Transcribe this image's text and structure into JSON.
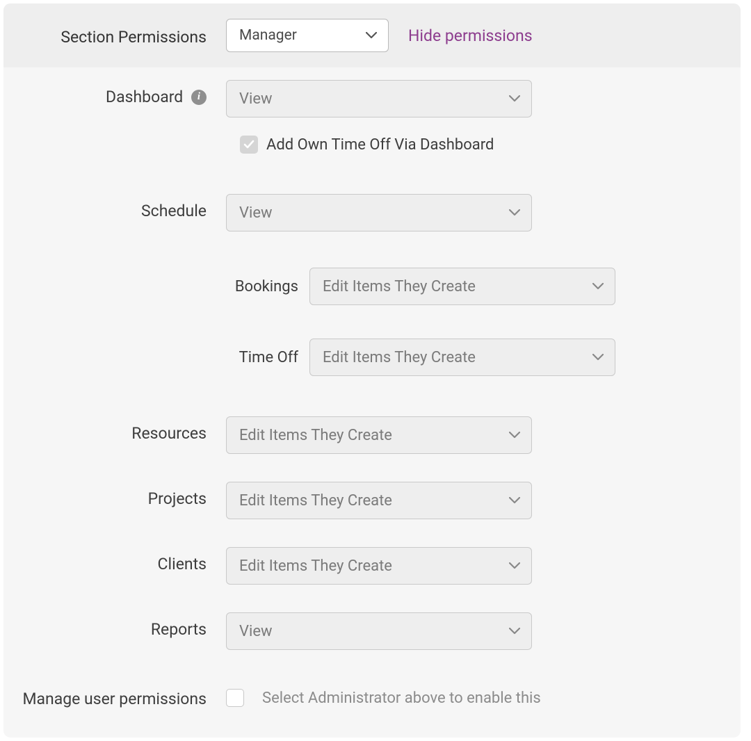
{
  "header": {
    "label": "Section Permissions",
    "role_value": "Manager",
    "hide_link": "Hide permissions"
  },
  "dashboard": {
    "label": "Dashboard",
    "value": "View",
    "checkbox_label": "Add Own Time Off Via Dashboard",
    "checkbox_checked": true
  },
  "schedule": {
    "label": "Schedule",
    "value": "View",
    "bookings": {
      "label": "Bookings",
      "value": "Edit Items They Create"
    },
    "timeoff": {
      "label": "Time Off",
      "value": "Edit Items They Create"
    }
  },
  "resources": {
    "label": "Resources",
    "value": "Edit Items They Create"
  },
  "projects": {
    "label": "Projects",
    "value": "Edit Items They Create"
  },
  "clients": {
    "label": "Clients",
    "value": "Edit Items They Create"
  },
  "reports": {
    "label": "Reports",
    "value": "View"
  },
  "manage_permissions": {
    "label": "Manage user permissions",
    "hint": "Select Administrator above to enable this",
    "checked": false
  }
}
